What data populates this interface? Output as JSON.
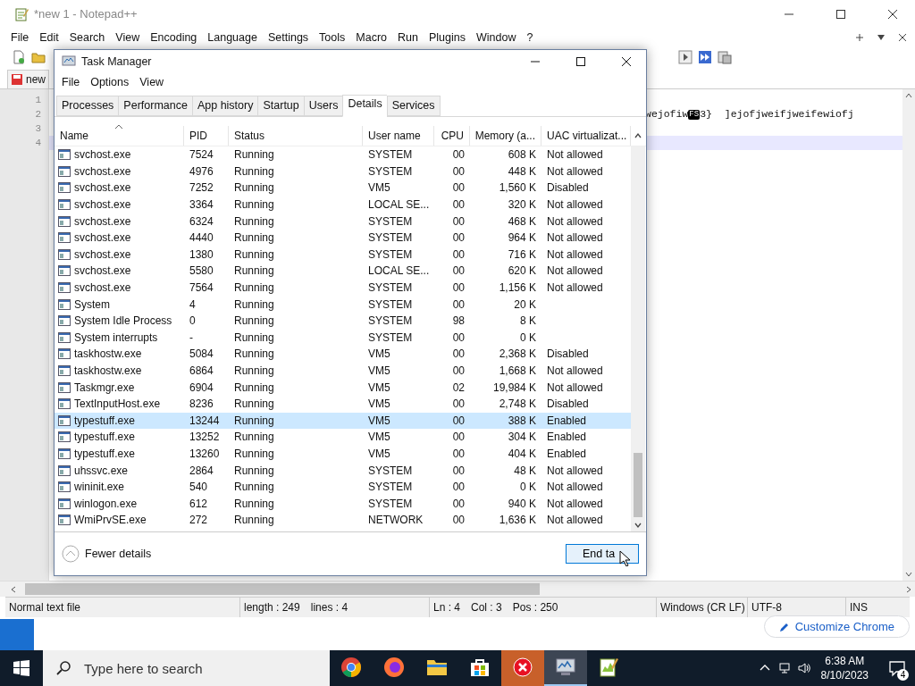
{
  "notepad": {
    "title": "*new 1 - Notepad++",
    "menu": [
      "File",
      "Edit",
      "Search",
      "View",
      "Encoding",
      "Language",
      "Settings",
      "Tools",
      "Macro",
      "Run",
      "Plugins",
      "Window",
      "?"
    ],
    "tab": "new",
    "lines": [
      {
        "number": "1",
        "current": false
      },
      {
        "number": "2",
        "current": false,
        "segments": [
          {
            "kind": "text",
            "text": "wejofiw"
          },
          {
            "kind": "control",
            "text": "FS"
          },
          {
            "kind": "text",
            "text": "3}  ]"
          },
          {
            "kind": "text",
            "text": "ejofjweifjweifewiofj"
          }
        ]
      },
      {
        "number": "3",
        "current": false
      },
      {
        "number": "4",
        "current": true
      }
    ],
    "status": {
      "type": "Normal text file",
      "length": "length : 249",
      "lines": "lines : 4",
      "ln": "Ln : 4",
      "col": "Col : 3",
      "pos": "Pos : 250",
      "eol": "Windows (CR LF)",
      "encoding": "UTF-8",
      "mode": "INS"
    }
  },
  "chrome": {
    "customize_button": "Customize Chrome"
  },
  "task_manager": {
    "title": "Task Manager",
    "menu": [
      "File",
      "Options",
      "View"
    ],
    "tabs": [
      {
        "label": "Processes",
        "selected": false
      },
      {
        "label": "Performance",
        "selected": false
      },
      {
        "label": "App history",
        "selected": false
      },
      {
        "label": "Startup",
        "selected": false
      },
      {
        "label": "Users",
        "selected": false
      },
      {
        "label": "Details",
        "selected": true
      },
      {
        "label": "Services",
        "selected": false
      }
    ],
    "columns": [
      "Name",
      "PID",
      "Status",
      "User name",
      "CPU",
      "Memory (a...",
      "UAC virtualizat..."
    ],
    "rows": [
      {
        "name": "svchost.exe",
        "pid": "7524",
        "status": "Running",
        "user": "SYSTEM",
        "cpu": "00",
        "memory": "608 K",
        "uac": "Not allowed",
        "selected": false
      },
      {
        "name": "svchost.exe",
        "pid": "4976",
        "status": "Running",
        "user": "SYSTEM",
        "cpu": "00",
        "memory": "448 K",
        "uac": "Not allowed",
        "selected": false
      },
      {
        "name": "svchost.exe",
        "pid": "7252",
        "status": "Running",
        "user": "VM5",
        "cpu": "00",
        "memory": "1,560 K",
        "uac": "Disabled",
        "selected": false
      },
      {
        "name": "svchost.exe",
        "pid": "3364",
        "status": "Running",
        "user": "LOCAL SE...",
        "cpu": "00",
        "memory": "320 K",
        "uac": "Not allowed",
        "selected": false
      },
      {
        "name": "svchost.exe",
        "pid": "6324",
        "status": "Running",
        "user": "SYSTEM",
        "cpu": "00",
        "memory": "468 K",
        "uac": "Not allowed",
        "selected": false
      },
      {
        "name": "svchost.exe",
        "pid": "4440",
        "status": "Running",
        "user": "SYSTEM",
        "cpu": "00",
        "memory": "964 K",
        "uac": "Not allowed",
        "selected": false
      },
      {
        "name": "svchost.exe",
        "pid": "1380",
        "status": "Running",
        "user": "SYSTEM",
        "cpu": "00",
        "memory": "716 K",
        "uac": "Not allowed",
        "selected": false
      },
      {
        "name": "svchost.exe",
        "pid": "5580",
        "status": "Running",
        "user": "LOCAL SE...",
        "cpu": "00",
        "memory": "620 K",
        "uac": "Not allowed",
        "selected": false
      },
      {
        "name": "svchost.exe",
        "pid": "7564",
        "status": "Running",
        "user": "SYSTEM",
        "cpu": "00",
        "memory": "1,156 K",
        "uac": "Not allowed",
        "selected": false
      },
      {
        "name": "System",
        "pid": "4",
        "status": "Running",
        "user": "SYSTEM",
        "cpu": "00",
        "memory": "20 K",
        "selected": false
      },
      {
        "name": "System Idle Process",
        "pid": "0",
        "status": "Running",
        "user": "SYSTEM",
        "cpu": "98",
        "memory": "8 K",
        "selected": false
      },
      {
        "name": "System interrupts",
        "pid": "-",
        "status": "Running",
        "user": "SYSTEM",
        "cpu": "00",
        "memory": "0 K",
        "selected": false
      },
      {
        "name": "taskhostw.exe",
        "pid": "5084",
        "status": "Running",
        "user": "VM5",
        "cpu": "00",
        "memory": "2,368 K",
        "uac": "Disabled",
        "selected": false
      },
      {
        "name": "taskhostw.exe",
        "pid": "6864",
        "status": "Running",
        "user": "VM5",
        "cpu": "00",
        "memory": "1,668 K",
        "uac": "Not allowed",
        "selected": false
      },
      {
        "name": "Taskmgr.exe",
        "pid": "6904",
        "status": "Running",
        "user": "VM5",
        "cpu": "02",
        "memory": "19,984 K",
        "uac": "Not allowed",
        "selected": false
      },
      {
        "name": "TextInputHost.exe",
        "pid": "8236",
        "status": "Running",
        "user": "VM5",
        "cpu": "00",
        "memory": "2,748 K",
        "uac": "Disabled",
        "selected": false
      },
      {
        "name": "typestuff.exe",
        "pid": "13244",
        "status": "Running",
        "user": "VM5",
        "cpu": "00",
        "memory": "388 K",
        "uac": "Enabled",
        "selected": true
      },
      {
        "name": "typestuff.exe",
        "pid": "13252",
        "status": "Running",
        "user": "VM5",
        "cpu": "00",
        "memory": "304 K",
        "uac": "Enabled",
        "selected": false
      },
      {
        "name": "typestuff.exe",
        "pid": "13260",
        "status": "Running",
        "user": "VM5",
        "cpu": "00",
        "memory": "404 K",
        "uac": "Enabled",
        "selected": false
      },
      {
        "name": "uhssvc.exe",
        "pid": "2864",
        "status": "Running",
        "user": "SYSTEM",
        "cpu": "00",
        "memory": "48 K",
        "uac": "Not allowed",
        "selected": false
      },
      {
        "name": "wininit.exe",
        "pid": "540",
        "status": "Running",
        "user": "SYSTEM",
        "cpu": "00",
        "memory": "0 K",
        "uac": "Not allowed",
        "selected": false
      },
      {
        "name": "winlogon.exe",
        "pid": "612",
        "status": "Running",
        "user": "SYSTEM",
        "cpu": "00",
        "memory": "940 K",
        "uac": "Not allowed",
        "selected": false
      },
      {
        "name": "WmiPrvSE.exe",
        "pid": "272",
        "status": "Running",
        "user": "NETWORK",
        "cpu": "00",
        "memory": "1,636 K",
        "uac": "Not allowed",
        "selected": false
      }
    ],
    "fewer_details": "Fewer details",
    "end_task": "End ta"
  },
  "taskbar": {
    "search_placeholder": "Type here to search",
    "apps": [
      {
        "kind": "chrome",
        "flashing": false,
        "selected": false
      },
      {
        "kind": "firefox",
        "flashing": false,
        "selected": false
      },
      {
        "kind": "folder",
        "flashing": false,
        "selected": false
      },
      {
        "kind": "store",
        "flashing": false,
        "selected": false
      },
      {
        "kind": "error",
        "flashing": true,
        "selected": false
      },
      {
        "kind": "monitor",
        "flashing": false,
        "selected": true
      },
      {
        "kind": "notepad",
        "flashing": false,
        "selected": false
      }
    ],
    "time": "6:38 AM",
    "date": "8/10/2023",
    "notifications": "4"
  }
}
